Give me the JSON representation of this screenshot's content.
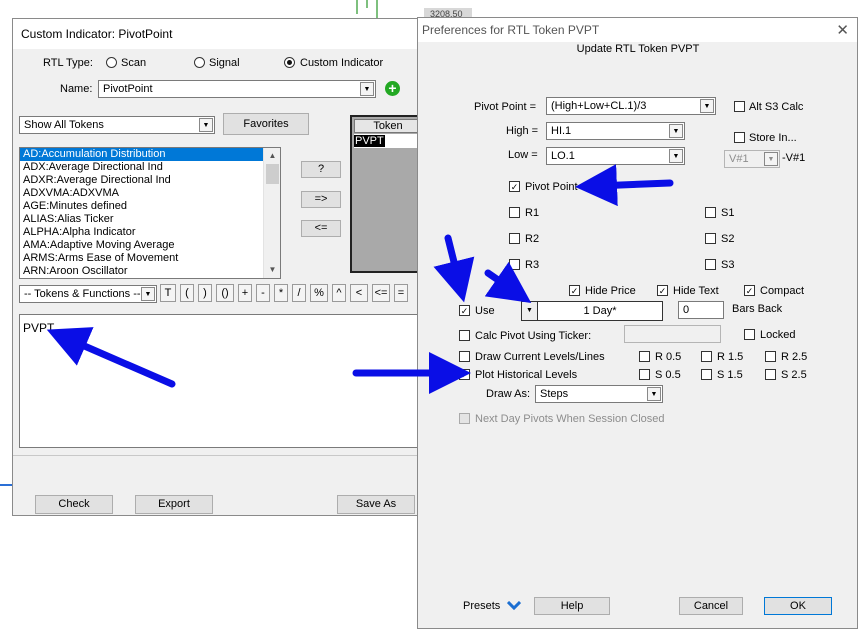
{
  "background": {
    "price_label": "3208.50",
    "accent_blue": "#0000ff"
  },
  "left_window": {
    "title": "Custom Indicator: PivotPoint",
    "rtl_type_label": "RTL Type:",
    "radio_scan": "Scan",
    "radio_signal": "Signal",
    "radio_custom": "Custom Indicator",
    "name_label": "Name:",
    "name_value": "PivotPoint",
    "tokens_filter": "Show All Tokens",
    "favorites_label": "Favorites",
    "token_items": [
      "AD:Accumulation Distribution",
      "ADX:Average Directional Ind",
      "ADXR:Average Directional Ind",
      "ADXVMA:ADXVMA",
      "AGE:Minutes defined",
      "ALIAS:Alias Ticker",
      "ALPHA:Alpha Indicator",
      "AMA:Adaptive Moving Average",
      "ARMS:Arms Ease of Movement",
      "ARN:Aroon Oscillator"
    ],
    "btn_question": "?",
    "btn_add": "=>",
    "btn_remove": "<=",
    "token_header": "Token",
    "token_value": "PVPT",
    "functions_select": "-- Tokens & Functions --",
    "operators": [
      "T",
      "(",
      ")",
      "()",
      "+",
      "-",
      "*",
      "/",
      "%",
      "^",
      "<",
      "<=",
      "="
    ],
    "formula_text": "PVPT",
    "check_label": "Check",
    "export_label": "Export",
    "saveas_label": "Save As"
  },
  "right_window": {
    "title": "Preferences for RTL Token PVPT",
    "close_glyph": "✕",
    "heading": "Update RTL Token PVPT",
    "pivot_point_label": "Pivot Point =",
    "pivot_point_value": "(High+Low+CL.1)/3",
    "alt_s3_label": "Alt S3 Calc",
    "high_label": "High =",
    "high_value": "HI.1",
    "low_label": "Low =",
    "low_value": "LO.1",
    "store_in_label": "Store In...",
    "store_in_value": "V#1",
    "store_in_suffix": "-V#1",
    "pivot_point_check": "Pivot Point",
    "r1": "R1",
    "r2": "R2",
    "r3": "R3",
    "s1": "S1",
    "s2": "S2",
    "s3": "S3",
    "hide_price": "Hide Price",
    "hide_text": "Hide Text",
    "compact": "Compact",
    "use_label": "Use",
    "period_value": "1 Day*",
    "bars_back_value": "0",
    "bars_back_label": "Bars Back",
    "calc_pivot_label": "Calc Pivot Using Ticker:",
    "locked_label": "Locked",
    "draw_current_label": "Draw Current Levels/Lines",
    "plot_hist_label": "Plot Historical Levels",
    "r05": "R 0.5",
    "r15": "R 1.5",
    "r25": "R 2.5",
    "s05": "S 0.5",
    "s15": "S 1.5",
    "s25": "S 2.5",
    "draw_as_label": "Draw As:",
    "draw_as_value": "Steps",
    "next_day_label": "Next Day Pivots When Session Closed",
    "presets_label": "Presets",
    "help_label": "Help",
    "cancel_label": "Cancel",
    "ok_label": "OK"
  }
}
